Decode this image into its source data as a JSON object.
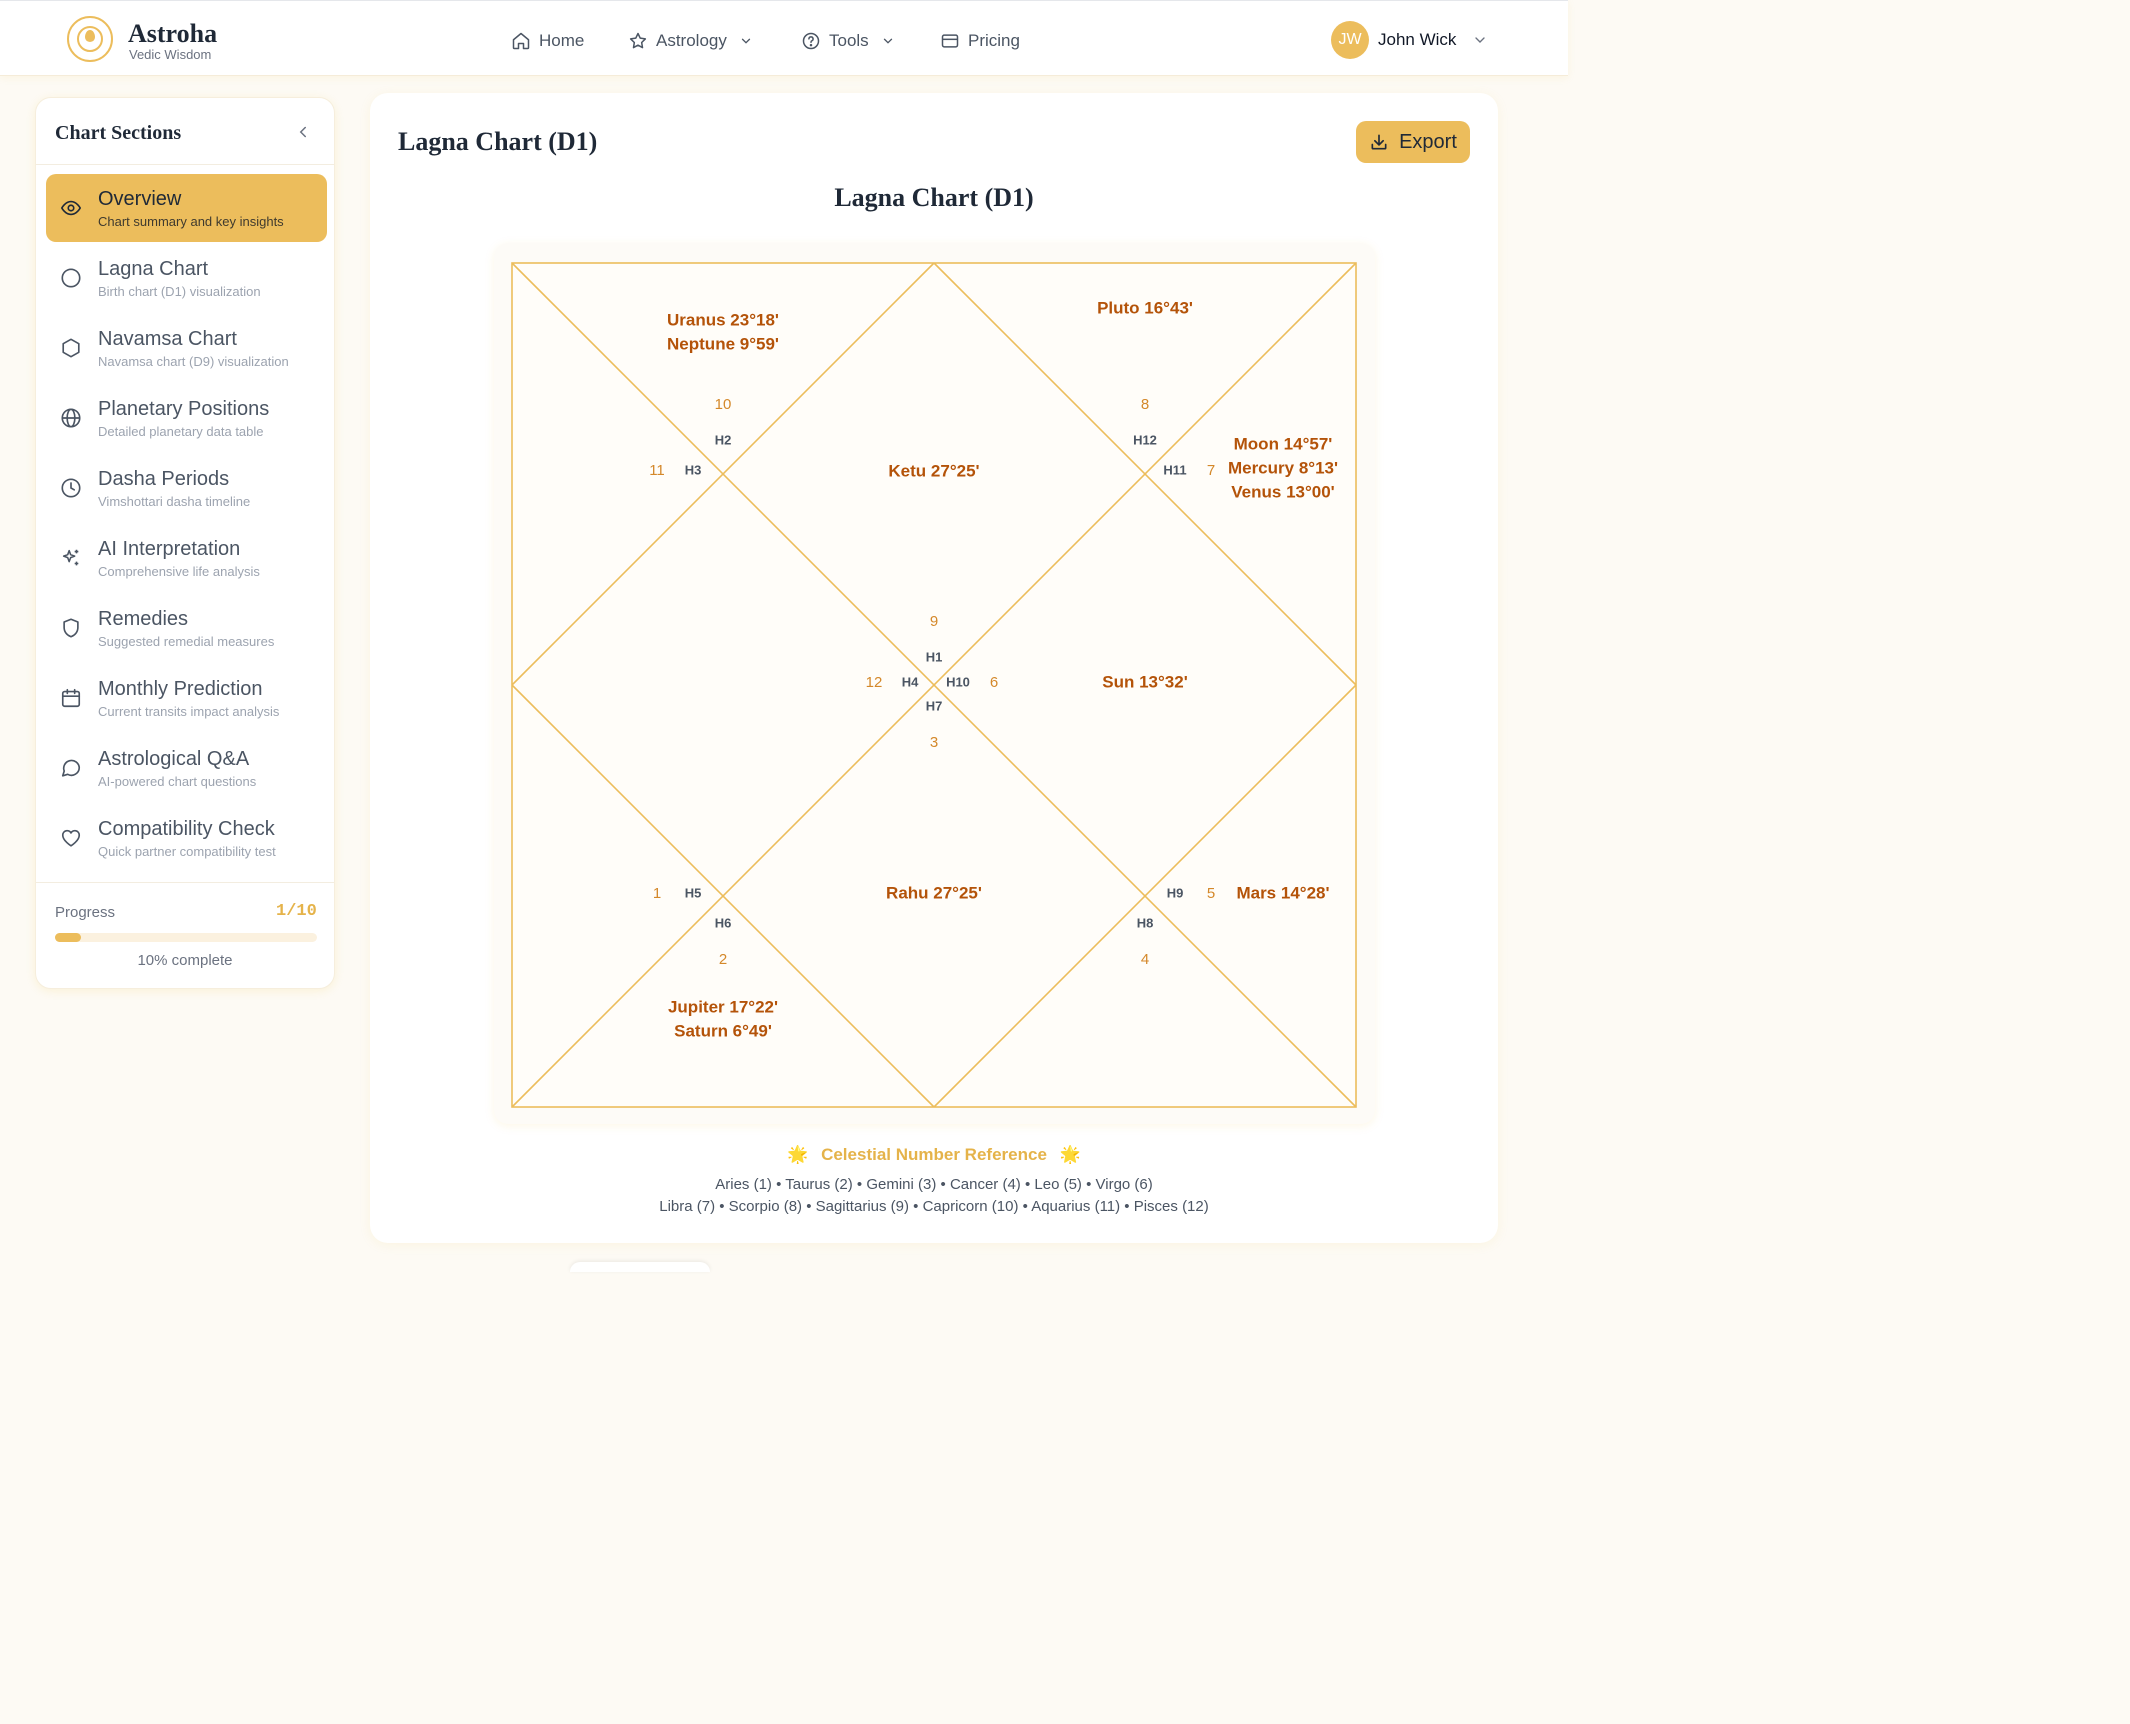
{
  "brand": {
    "name": "Astroha",
    "tagline": "Vedic Wisdom"
  },
  "nav": {
    "items": [
      {
        "label": "Home",
        "icon": "home-icon"
      },
      {
        "label": "Astrology",
        "icon": "star-icon",
        "dropdown": true
      },
      {
        "label": "Tools",
        "icon": "help-circle-icon",
        "dropdown": true
      },
      {
        "label": "Pricing",
        "icon": "credit-card-icon"
      }
    ]
  },
  "user": {
    "initials": "JW",
    "name": "John Wick"
  },
  "sidebar": {
    "title": "Chart Sections",
    "items": [
      {
        "label": "Overview",
        "desc": "Chart summary and key insights",
        "icon": "eye-icon",
        "active": true
      },
      {
        "label": "Lagna Chart",
        "desc": "Birth chart (D1) visualization",
        "icon": "circle-icon"
      },
      {
        "label": "Navamsa Chart",
        "desc": "Navamsa chart (D9) visualization",
        "icon": "hexagon-icon"
      },
      {
        "label": "Planetary Positions",
        "desc": "Detailed planetary data table",
        "icon": "globe-icon"
      },
      {
        "label": "Dasha Periods",
        "desc": "Vimshottari dasha timeline",
        "icon": "clock-icon"
      },
      {
        "label": "AI Interpretation",
        "desc": "Comprehensive life analysis",
        "icon": "sparkles-icon"
      },
      {
        "label": "Remedies",
        "desc": "Suggested remedial measures",
        "icon": "shield-icon"
      },
      {
        "label": "Monthly Prediction",
        "desc": "Current transits impact analysis",
        "icon": "calendar-icon"
      },
      {
        "label": "Astrological Q&A",
        "desc": "AI-powered chart questions",
        "icon": "message-circle-icon"
      },
      {
        "label": "Compatibility Check",
        "desc": "Quick partner compatibility test",
        "icon": "heart-icon"
      }
    ],
    "progress": {
      "label": "Progress",
      "count": "1/10",
      "fraction": 0.1,
      "percent_text": "10% complete"
    }
  },
  "main": {
    "title": "Lagna Chart (D1)",
    "export_label": "Export",
    "chart_title": "Lagna Chart (D1)"
  },
  "chart": {
    "houses": [
      {
        "house": "H1",
        "sign": "9",
        "planets": []
      },
      {
        "house": "H2",
        "sign": "10",
        "planets": [
          "Uranus 23°18'",
          "Neptune 9°59'"
        ]
      },
      {
        "house": "H3",
        "sign": "11",
        "planets": []
      },
      {
        "house": "H4",
        "sign": "12",
        "planets": []
      },
      {
        "house": "H5",
        "sign": "1",
        "planets": []
      },
      {
        "house": "H6",
        "sign": "2",
        "planets": [
          "Jupiter 17°22'",
          "Saturn 6°49'"
        ]
      },
      {
        "house": "H7",
        "sign": "3",
        "planets": [
          "Rahu 27°25'"
        ]
      },
      {
        "house": "H8",
        "sign": "4",
        "planets": []
      },
      {
        "house": "H9",
        "sign": "5",
        "planets": [
          "Mars 14°28'"
        ]
      },
      {
        "house": "H10",
        "sign": "6",
        "planets": [
          "Sun 13°32'"
        ]
      },
      {
        "house": "H11",
        "sign": "7",
        "planets": [
          "Moon 14°57'",
          "Mercury 8°13'",
          "Venus 13°00'"
        ]
      },
      {
        "house": "H12",
        "sign": "8",
        "planets": [
          "Pluto 16°43'"
        ]
      }
    ],
    "center_planets": [
      "Ketu 27°25'"
    ],
    "colors": {
      "line": "#ecbd5c",
      "sign": "#d4882a",
      "house": "#4b5563",
      "planet": "#b45309"
    }
  },
  "reference": {
    "title": "Celestial Number Reference",
    "line1": "Aries (1) • Taurus (2) • Gemini (3) • Cancer (4) • Leo (5) • Virgo (6)",
    "line2": "Libra (7) • Scorpio (8) • Sagittarius (9) • Capricorn (10) • Aquarius (11) • Pisces (12)"
  }
}
